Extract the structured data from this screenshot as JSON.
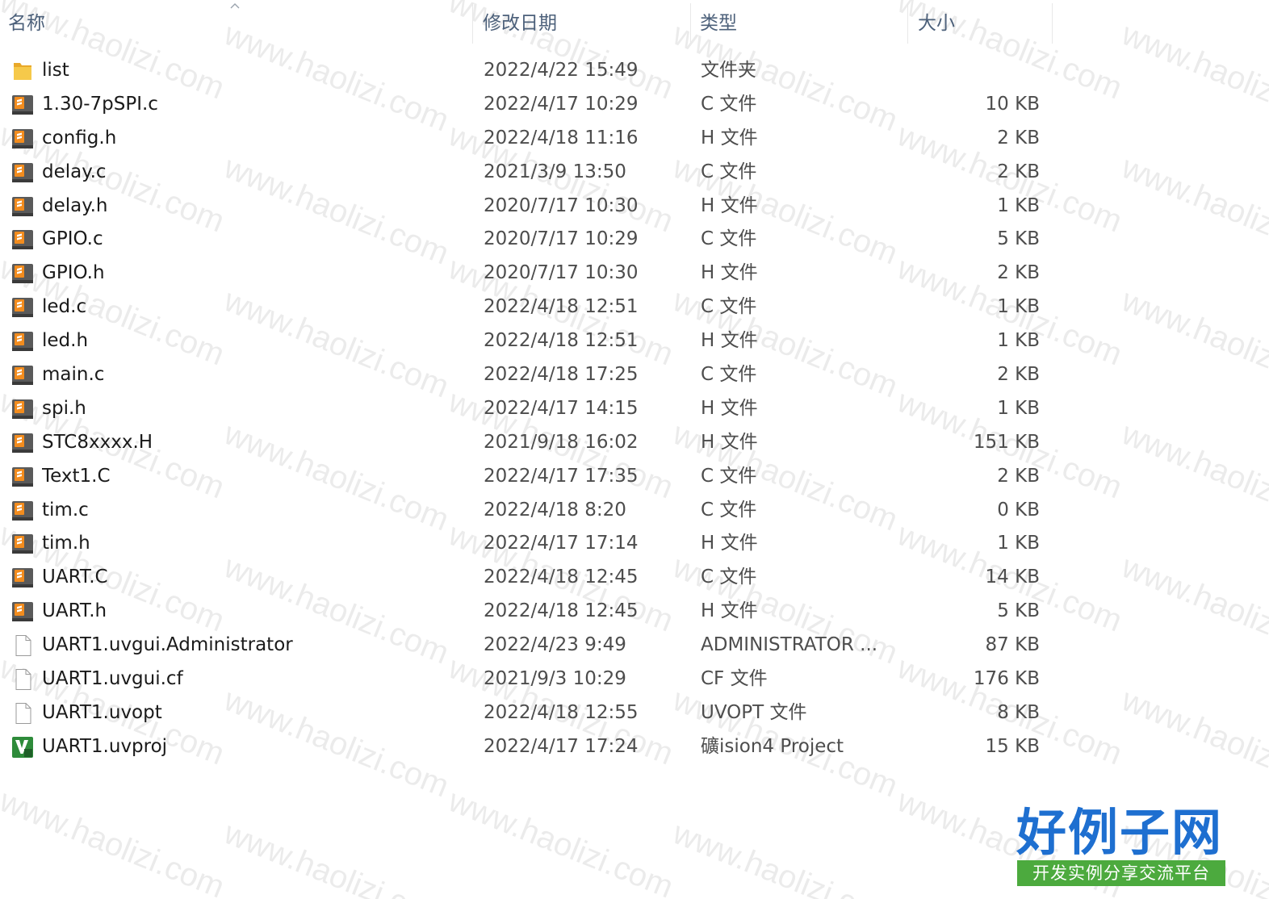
{
  "columns": {
    "name": "名称",
    "date": "修改日期",
    "type": "类型",
    "size": "大小"
  },
  "files": [
    {
      "name": "list",
      "date": "2022/4/22 15:49",
      "type": "文件夹",
      "size": "",
      "icon": "folder-icon"
    },
    {
      "name": "1.30-7pSPI.c",
      "date": "2022/4/17 10:29",
      "type": "C 文件",
      "size": "10 KB",
      "icon": "sublime-file-icon"
    },
    {
      "name": "config.h",
      "date": "2022/4/18 11:16",
      "type": "H 文件",
      "size": "2 KB",
      "icon": "sublime-file-icon"
    },
    {
      "name": "delay.c",
      "date": "2021/3/9 13:50",
      "type": "C 文件",
      "size": "2 KB",
      "icon": "sublime-file-icon"
    },
    {
      "name": "delay.h",
      "date": "2020/7/17 10:30",
      "type": "H 文件",
      "size": "1 KB",
      "icon": "sublime-file-icon"
    },
    {
      "name": "GPIO.c",
      "date": "2020/7/17 10:29",
      "type": "C 文件",
      "size": "5 KB",
      "icon": "sublime-file-icon"
    },
    {
      "name": "GPIO.h",
      "date": "2020/7/17 10:30",
      "type": "H 文件",
      "size": "2 KB",
      "icon": "sublime-file-icon"
    },
    {
      "name": "led.c",
      "date": "2022/4/18 12:51",
      "type": "C 文件",
      "size": "1 KB",
      "icon": "sublime-file-icon"
    },
    {
      "name": "led.h",
      "date": "2022/4/18 12:51",
      "type": "H 文件",
      "size": "1 KB",
      "icon": "sublime-file-icon"
    },
    {
      "name": "main.c",
      "date": "2022/4/18 17:25",
      "type": "C 文件",
      "size": "2 KB",
      "icon": "sublime-file-icon"
    },
    {
      "name": "spi.h",
      "date": "2022/4/17 14:15",
      "type": "H 文件",
      "size": "1 KB",
      "icon": "sublime-file-icon"
    },
    {
      "name": "STC8xxxx.H",
      "date": "2021/9/18 16:02",
      "type": "H 文件",
      "size": "151 KB",
      "icon": "sublime-file-icon"
    },
    {
      "name": "Text1.C",
      "date": "2022/4/17 17:35",
      "type": "C 文件",
      "size": "2 KB",
      "icon": "sublime-file-icon"
    },
    {
      "name": "tim.c",
      "date": "2022/4/18 8:20",
      "type": "C 文件",
      "size": "0 KB",
      "icon": "sublime-file-icon"
    },
    {
      "name": "tim.h",
      "date": "2022/4/17 17:14",
      "type": "H 文件",
      "size": "1 KB",
      "icon": "sublime-file-icon"
    },
    {
      "name": "UART.C",
      "date": "2022/4/18 12:45",
      "type": "C 文件",
      "size": "14 KB",
      "icon": "sublime-file-icon"
    },
    {
      "name": "UART.h",
      "date": "2022/4/18 12:45",
      "type": "H 文件",
      "size": "5 KB",
      "icon": "sublime-file-icon"
    },
    {
      "name": "UART1.uvgui.Administrator",
      "date": "2022/4/23 9:49",
      "type": "ADMINISTRATOR ...",
      "size": "87 KB",
      "icon": "blank-file-icon"
    },
    {
      "name": "UART1.uvgui.cf",
      "date": "2021/9/3 10:29",
      "type": "CF 文件",
      "size": "176 KB",
      "icon": "blank-file-icon"
    },
    {
      "name": "UART1.uvopt",
      "date": "2022/4/18 12:55",
      "type": "UVOPT 文件",
      "size": "8 KB",
      "icon": "blank-file-icon"
    },
    {
      "name": "UART1.uvproj",
      "date": "2022/4/17 17:24",
      "type": "礦ision4 Project",
      "size": "15 KB",
      "icon": "keil-project-icon"
    }
  ],
  "watermark_text": "www.haolizi.com",
  "logo": {
    "main": "好例子网",
    "sub": "开发实例分享交流平台"
  },
  "colors": {
    "header_text": "#4c607a",
    "logo_blue": "#1e6fd0",
    "logo_green": "#4caa3e",
    "folder_yellow": "#f3c043",
    "sublime_orange": "#f28c1e",
    "keil_green": "#2e8b3a"
  }
}
